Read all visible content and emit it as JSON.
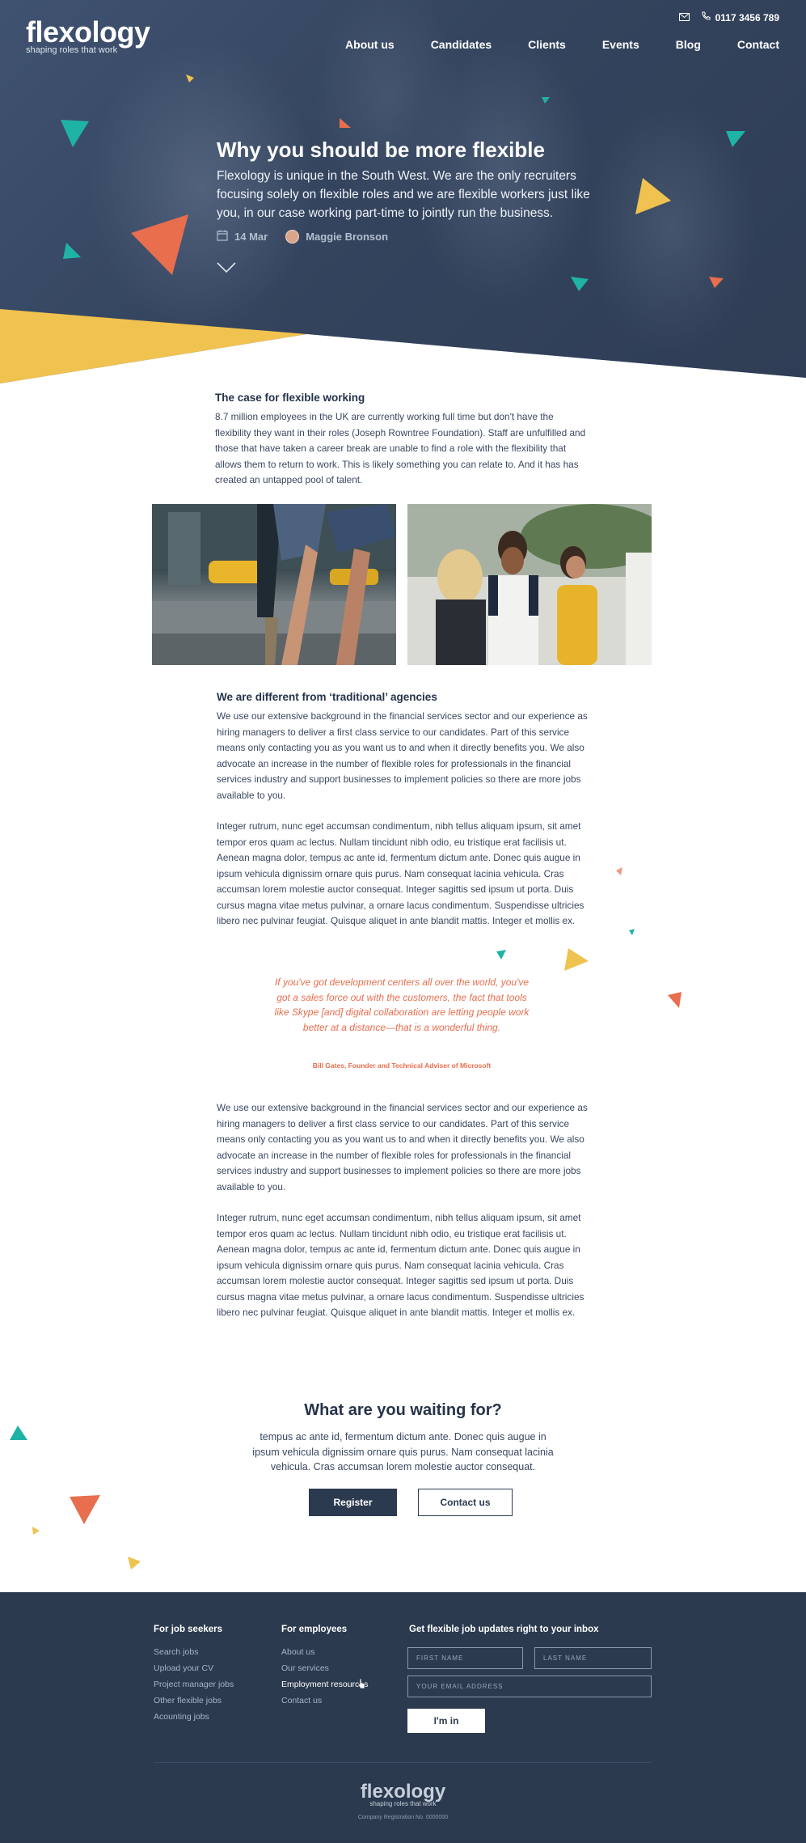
{
  "brand": {
    "name": "flexology",
    "tagline": "shaping roles that work"
  },
  "topbar": {
    "phone": "0117 3456 789"
  },
  "nav": [
    "About us",
    "Candidates",
    "Clients",
    "Events",
    "Blog",
    "Contact"
  ],
  "hero": {
    "title": "Why you should be more flexible",
    "subtitle": "Flexology is unique in the South West. We are the only recruiters focusing solely on flexible roles and we are flexible workers just like you, in our case working part-time to jointly run the business.",
    "date": "14 Mar",
    "author": "Maggie Bronson"
  },
  "article": {
    "section1_heading": "The case for flexible working",
    "section1_para": "8.7 million employees in the UK are currently working full time but don't have the flexibility they want in their roles (Joseph Rowntree Foundation). Staff are unfulfilled and those that have taken a career break are unable to find a role with the flexibility that allows them to return to work. This is likely something you can relate to. And it has has created an untapped pool of talent.",
    "section2_heading": "We are different from ‘traditional’ agencies",
    "para_a": "We use our extensive background in the financial services sector and our experience as hiring managers to deliver a first class service to our candidates. Part of this service means only contacting you as you want us to and when it directly benefits you. We also advocate an increase in the number of flexible roles for professionals in the financial services industry and support businesses to implement policies so there are more jobs available to you.",
    "para_b": "Integer rutrum, nunc eget accumsan condimentum, nibh tellus aliquam ipsum, sit amet tempor eros quam ac lectus. Nullam tincidunt nibh odio, eu tristique erat facilisis ut. Aenean magna dolor, tempus ac ante id, fermentum dictum ante. Donec quis augue in ipsum vehicula dignissim ornare quis purus. Nam consequat lacinia vehicula. Cras accumsan lorem molestie auctor consequat. Integer sagittis sed ipsum ut porta. Duis cursus magna vitae metus pulvinar, a ornare lacus condimentum. Suspendisse ultricies libero nec pulvinar feugiat. Quisque aliquet in ante blandit mattis. Integer et mollis ex.",
    "quote": "If you've got development centers all over the world, you've got a sales force out with the customers, the fact that tools like Skype [and] digital collaboration are letting people work better at a distance—that is a wonderful thing.",
    "quote_source": "Bill Gates, Founder and Technical Adviser of Microsoft"
  },
  "cta": {
    "title": "What are you waiting for?",
    "text": "tempus ac ante id, fermentum dictum ante. Donec quis augue in ipsum vehicula dignissim ornare quis purus. Nam consequat lacinia vehicula. Cras accumsan lorem molestie auctor consequat.",
    "register": "Register",
    "contact": "Contact us"
  },
  "footer": {
    "col1_title": "For job seekers",
    "col1_links": [
      "Search jobs",
      "Upload your CV",
      "Project manager jobs",
      "Other flexible jobs",
      "Acounting jobs"
    ],
    "col2_title": "For employees",
    "col2_links": [
      "About us",
      "Our services",
      "Employment resources",
      "Contact us"
    ],
    "newsletter_title": "Get flexible job updates right to your inbox",
    "first_name_placeholder": "FIRST NAME",
    "last_name_placeholder": "LAST NAME",
    "email_placeholder": "YOUR EMAIL ADDRESS",
    "submit": "I'm in",
    "registration": "Company Registration No. 0000000"
  },
  "colors": {
    "navy": "#2b3a4e",
    "teal": "#1fb3a6",
    "yellow": "#f0c24f",
    "coral": "#e86e4e"
  }
}
